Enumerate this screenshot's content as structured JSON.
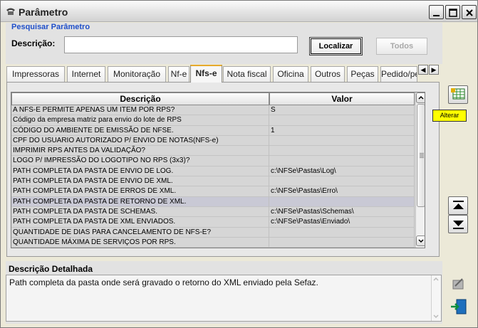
{
  "window": {
    "title": "Parâmetro",
    "buttons": [
      "minimize",
      "maximize",
      "close"
    ]
  },
  "search": {
    "section_title": "Pesquisar Parâmetro",
    "description_label": "Descrição:",
    "description_value": "",
    "find_button": "Localizar",
    "all_button": "Todos"
  },
  "tabs": [
    {
      "label": "Impressoras"
    },
    {
      "label": "Internet"
    },
    {
      "label": "Monitoração"
    },
    {
      "label": "Nf-e"
    },
    {
      "label": "Nfs-e",
      "active": true
    },
    {
      "label": "Nota fiscal"
    },
    {
      "label": "Oficina"
    },
    {
      "label": "Outros"
    },
    {
      "label": "Peças"
    },
    {
      "label": "Pedido/peças"
    }
  ],
  "grid": {
    "columns": [
      "Descrição",
      "Valor"
    ],
    "rows": [
      {
        "descricao": "A NFS-E PERMITE APENAS UM ITEM POR RPS?",
        "valor": "S"
      },
      {
        "descricao": "Código da empresa matriz para envio do lote de RPS",
        "valor": ""
      },
      {
        "descricao": "CÓDIGO DO AMBIENTE DE EMISSÃO DE NFSE.",
        "valor": "1"
      },
      {
        "descricao": "CPF DO USUARIO AUTORIZADO P/ ENVIO DE NOTAS(NFS-e)",
        "valor": ""
      },
      {
        "descricao": "IMPRIMIR RPS ANTES DA VALIDAÇÃO?",
        "valor": ""
      },
      {
        "descricao": "LOGO P/ IMPRESSÃO DO LOGOTIPO NO RPS (3x3)?",
        "valor": ""
      },
      {
        "descricao": "PATH COMPLETA DA PASTA DE ENVIO DE LOG.",
        "valor": "c:\\NFSe\\Pastas\\Log\\"
      },
      {
        "descricao": "PATH COMPLETA DA PASTA DE ENVIO DE XML.",
        "valor": ""
      },
      {
        "descricao": "PATH COMPLETA DA PASTA DE ERROS DE XML.",
        "valor": "c:\\NFSe\\Pastas\\Erro\\"
      },
      {
        "descricao": "PATH COMPLETA DA PASTA DE RETORNO DE XML.",
        "valor": "",
        "selected": true
      },
      {
        "descricao": "PATH COMPLETA DA PASTA DE SCHEMAS.",
        "valor": "c:\\NFSe\\Pastas\\Schemas\\"
      },
      {
        "descricao": "PATH COMPLETA DA PASTA DE XML ENVIADOS.",
        "valor": "c:\\NFSe\\Pastas\\Enviado\\"
      },
      {
        "descricao": "QUANTIDADE DE DIAS PARA CANCELAMENTO DE NFS-E?",
        "valor": ""
      },
      {
        "descricao": "QUANTIDADE MÁXIMA DE SERVIÇOS POR RPS.",
        "valor": ""
      }
    ]
  },
  "tooltip": {
    "text": "Alterar"
  },
  "toolbar": {
    "icons": [
      "edit-grid-icon",
      "move-top-icon",
      "move-bottom-icon",
      "disabled-action-icon",
      "exit-icon"
    ]
  },
  "detail": {
    "title": "Descrição Detalhada",
    "text": "Path completa da pasta onde será gravado o retorno do XML enviado pela Sefaz."
  }
}
